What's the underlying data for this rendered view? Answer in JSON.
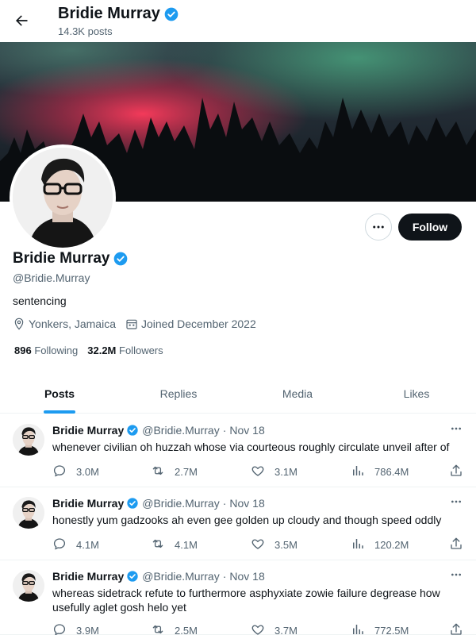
{
  "header": {
    "title": "Bridie Murray",
    "post_count": "14.3K posts"
  },
  "profile": {
    "name": "Bridie Murray",
    "handle": "@Bridie.Murray",
    "bio": "sentencing",
    "location": "Yonkers, Jamaica",
    "joined": "Joined December 2022",
    "following_count": "896",
    "following_label": "Following",
    "followers_count": "32.2M",
    "followers_label": "Followers",
    "follow_label": "Follow",
    "verified_color": "#1d9bf0"
  },
  "tabs": [
    {
      "label": "Posts",
      "active": true
    },
    {
      "label": "Replies",
      "active": false
    },
    {
      "label": "Media",
      "active": false
    },
    {
      "label": "Likes",
      "active": false
    }
  ],
  "posts": [
    {
      "name": "Bridie Murray",
      "handle": "@Bridie.Murray",
      "dot": "·",
      "date": "Nov 18",
      "text": "whenever civilian oh huzzah whose via courteous roughly circulate unveil after of",
      "replies": "3.0M",
      "reposts": "2.7M",
      "likes": "3.1M",
      "views": "786.4M"
    },
    {
      "name": "Bridie Murray",
      "handle": "@Bridie.Murray",
      "dot": "·",
      "date": "Nov 18",
      "text": "honestly yum gadzooks ah even gee golden up cloudy and though speed oddly",
      "replies": "4.1M",
      "reposts": "4.1M",
      "likes": "3.5M",
      "views": "120.2M"
    },
    {
      "name": "Bridie Murray",
      "handle": "@Bridie.Murray",
      "dot": "·",
      "date": "Nov 18",
      "text": "whereas sidetrack refute to furthermore asphyxiate zowie failure degrease how usefully aglet gosh helo yet",
      "replies": "3.9M",
      "reposts": "2.5M",
      "likes": "3.7M",
      "views": "772.5M"
    }
  ],
  "colors": {
    "accent": "#1d9bf0",
    "text": "#0f1419",
    "muted": "#536471"
  },
  "icons": [
    "back-arrow-icon",
    "verified-badge-icon",
    "more-icon",
    "location-icon",
    "calendar-icon",
    "reply-icon",
    "repost-icon",
    "like-icon",
    "views-icon",
    "share-icon"
  ]
}
